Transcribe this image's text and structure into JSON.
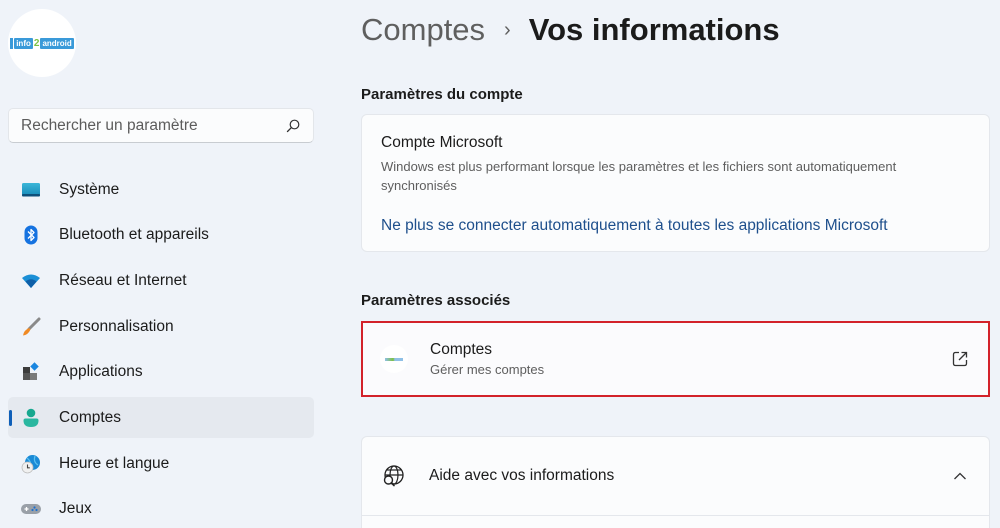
{
  "sidebar": {
    "avatar_logo": {
      "part1": "info",
      "part2": "2",
      "part3": "android"
    },
    "search": {
      "placeholder": "Rechercher un paramètre",
      "value": ""
    },
    "items": [
      {
        "label": "Système",
        "icon": "system-monitor-icon",
        "active": false
      },
      {
        "label": "Bluetooth et appareils",
        "icon": "bluetooth-icon",
        "active": false
      },
      {
        "label": "Réseau et Internet",
        "icon": "wifi-icon",
        "active": false
      },
      {
        "label": "Personnalisation",
        "icon": "paintbrush-icon",
        "active": false
      },
      {
        "label": "Applications",
        "icon": "apps-icon",
        "active": false
      },
      {
        "label": "Comptes",
        "icon": "person-icon",
        "active": true
      },
      {
        "label": "Heure et langue",
        "icon": "globe-clock-icon",
        "active": false
      },
      {
        "label": "Jeux",
        "icon": "gamepad-icon",
        "active": false
      }
    ]
  },
  "header": {
    "breadcrumb_parent": "Comptes",
    "breadcrumb_separator": "›",
    "breadcrumb_current": "Vos informations"
  },
  "account_settings": {
    "title": "Paramètres du compte",
    "microsoft_account": {
      "title": "Compte Microsoft",
      "description": "Windows est plus performant lorsque les paramètres et les fichiers sont automatiquement synchronisés",
      "link": "Ne plus se connecter automatiquement à toutes les applications Microsoft"
    }
  },
  "related_settings": {
    "title": "Paramètres associés",
    "accounts": {
      "title": "Comptes",
      "subtitle": "Gérer mes comptes",
      "icon": "external-link-icon"
    }
  },
  "help": {
    "title": "Aide avec vos informations",
    "expanded": true
  },
  "colors": {
    "accent": "#0f5fb8",
    "link": "#1e4f8c",
    "highlight_border": "#d3222a",
    "background": "#eff3f9"
  }
}
